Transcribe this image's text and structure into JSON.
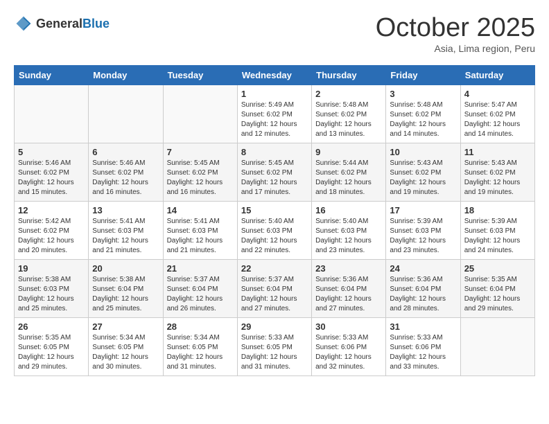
{
  "header": {
    "logo": {
      "text_general": "General",
      "text_blue": "Blue"
    },
    "month_title": "October 2025",
    "subtitle": "Asia, Lima region, Peru"
  },
  "weekdays": [
    "Sunday",
    "Monday",
    "Tuesday",
    "Wednesday",
    "Thursday",
    "Friday",
    "Saturday"
  ],
  "weeks": [
    [
      {
        "day": "",
        "info": ""
      },
      {
        "day": "",
        "info": ""
      },
      {
        "day": "",
        "info": ""
      },
      {
        "day": "1",
        "info": "Sunrise: 5:49 AM\nSunset: 6:02 PM\nDaylight: 12 hours\nand 12 minutes."
      },
      {
        "day": "2",
        "info": "Sunrise: 5:48 AM\nSunset: 6:02 PM\nDaylight: 12 hours\nand 13 minutes."
      },
      {
        "day": "3",
        "info": "Sunrise: 5:48 AM\nSunset: 6:02 PM\nDaylight: 12 hours\nand 14 minutes."
      },
      {
        "day": "4",
        "info": "Sunrise: 5:47 AM\nSunset: 6:02 PM\nDaylight: 12 hours\nand 14 minutes."
      }
    ],
    [
      {
        "day": "5",
        "info": "Sunrise: 5:46 AM\nSunset: 6:02 PM\nDaylight: 12 hours\nand 15 minutes."
      },
      {
        "day": "6",
        "info": "Sunrise: 5:46 AM\nSunset: 6:02 PM\nDaylight: 12 hours\nand 16 minutes."
      },
      {
        "day": "7",
        "info": "Sunrise: 5:45 AM\nSunset: 6:02 PM\nDaylight: 12 hours\nand 16 minutes."
      },
      {
        "day": "8",
        "info": "Sunrise: 5:45 AM\nSunset: 6:02 PM\nDaylight: 12 hours\nand 17 minutes."
      },
      {
        "day": "9",
        "info": "Sunrise: 5:44 AM\nSunset: 6:02 PM\nDaylight: 12 hours\nand 18 minutes."
      },
      {
        "day": "10",
        "info": "Sunrise: 5:43 AM\nSunset: 6:02 PM\nDaylight: 12 hours\nand 19 minutes."
      },
      {
        "day": "11",
        "info": "Sunrise: 5:43 AM\nSunset: 6:02 PM\nDaylight: 12 hours\nand 19 minutes."
      }
    ],
    [
      {
        "day": "12",
        "info": "Sunrise: 5:42 AM\nSunset: 6:02 PM\nDaylight: 12 hours\nand 20 minutes."
      },
      {
        "day": "13",
        "info": "Sunrise: 5:41 AM\nSunset: 6:03 PM\nDaylight: 12 hours\nand 21 minutes."
      },
      {
        "day": "14",
        "info": "Sunrise: 5:41 AM\nSunset: 6:03 PM\nDaylight: 12 hours\nand 21 minutes."
      },
      {
        "day": "15",
        "info": "Sunrise: 5:40 AM\nSunset: 6:03 PM\nDaylight: 12 hours\nand 22 minutes."
      },
      {
        "day": "16",
        "info": "Sunrise: 5:40 AM\nSunset: 6:03 PM\nDaylight: 12 hours\nand 23 minutes."
      },
      {
        "day": "17",
        "info": "Sunrise: 5:39 AM\nSunset: 6:03 PM\nDaylight: 12 hours\nand 23 minutes."
      },
      {
        "day": "18",
        "info": "Sunrise: 5:39 AM\nSunset: 6:03 PM\nDaylight: 12 hours\nand 24 minutes."
      }
    ],
    [
      {
        "day": "19",
        "info": "Sunrise: 5:38 AM\nSunset: 6:03 PM\nDaylight: 12 hours\nand 25 minutes."
      },
      {
        "day": "20",
        "info": "Sunrise: 5:38 AM\nSunset: 6:04 PM\nDaylight: 12 hours\nand 25 minutes."
      },
      {
        "day": "21",
        "info": "Sunrise: 5:37 AM\nSunset: 6:04 PM\nDaylight: 12 hours\nand 26 minutes."
      },
      {
        "day": "22",
        "info": "Sunrise: 5:37 AM\nSunset: 6:04 PM\nDaylight: 12 hours\nand 27 minutes."
      },
      {
        "day": "23",
        "info": "Sunrise: 5:36 AM\nSunset: 6:04 PM\nDaylight: 12 hours\nand 27 minutes."
      },
      {
        "day": "24",
        "info": "Sunrise: 5:36 AM\nSunset: 6:04 PM\nDaylight: 12 hours\nand 28 minutes."
      },
      {
        "day": "25",
        "info": "Sunrise: 5:35 AM\nSunset: 6:04 PM\nDaylight: 12 hours\nand 29 minutes."
      }
    ],
    [
      {
        "day": "26",
        "info": "Sunrise: 5:35 AM\nSunset: 6:05 PM\nDaylight: 12 hours\nand 29 minutes."
      },
      {
        "day": "27",
        "info": "Sunrise: 5:34 AM\nSunset: 6:05 PM\nDaylight: 12 hours\nand 30 minutes."
      },
      {
        "day": "28",
        "info": "Sunrise: 5:34 AM\nSunset: 6:05 PM\nDaylight: 12 hours\nand 31 minutes."
      },
      {
        "day": "29",
        "info": "Sunrise: 5:33 AM\nSunset: 6:05 PM\nDaylight: 12 hours\nand 31 minutes."
      },
      {
        "day": "30",
        "info": "Sunrise: 5:33 AM\nSunset: 6:06 PM\nDaylight: 12 hours\nand 32 minutes."
      },
      {
        "day": "31",
        "info": "Sunrise: 5:33 AM\nSunset: 6:06 PM\nDaylight: 12 hours\nand 33 minutes."
      },
      {
        "day": "",
        "info": ""
      }
    ]
  ]
}
